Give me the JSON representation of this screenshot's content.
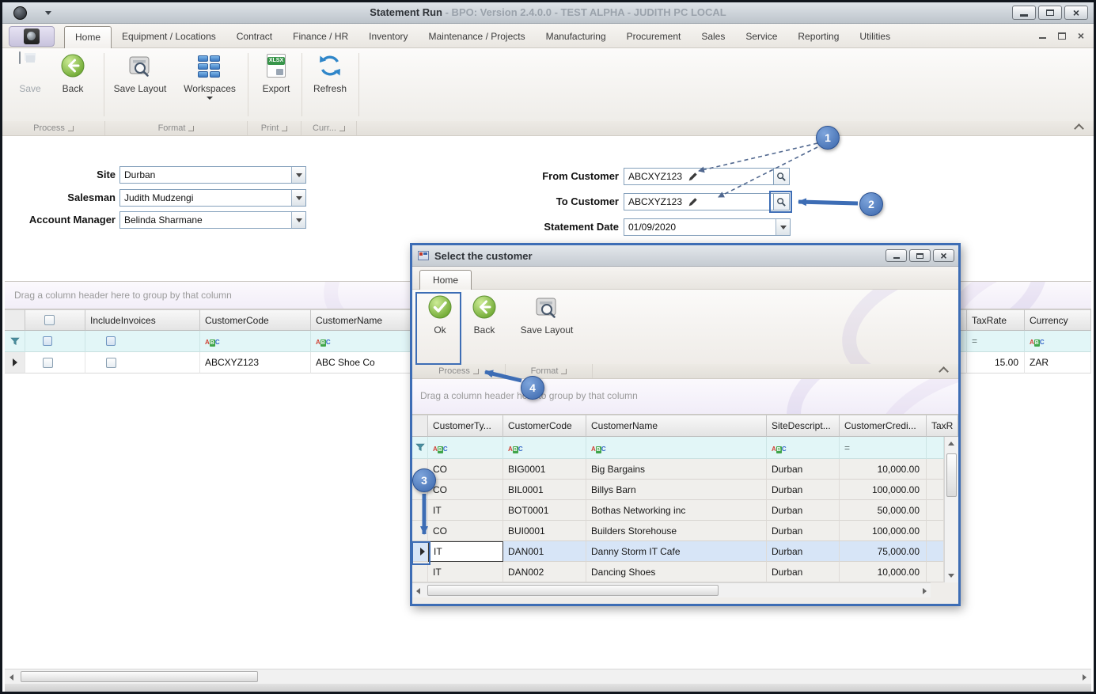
{
  "titlebar": {
    "title": "Statement Run",
    "subtitle": "- BPO: Version 2.4.0.0 - TEST ALPHA - JUDITH PC LOCAL"
  },
  "ribbon": {
    "tabs": [
      {
        "label": "Home"
      },
      {
        "label": "Equipment / Locations"
      },
      {
        "label": "Contract"
      },
      {
        "label": "Finance / HR"
      },
      {
        "label": "Inventory"
      },
      {
        "label": "Maintenance / Projects"
      },
      {
        "label": "Manufacturing"
      },
      {
        "label": "Procurement"
      },
      {
        "label": "Sales"
      },
      {
        "label": "Service"
      },
      {
        "label": "Reporting"
      },
      {
        "label": "Utilities"
      }
    ],
    "buttons": {
      "save": "Save",
      "back": "Back",
      "save_layout": "Save Layout",
      "workspaces": "Workspaces",
      "export": "Export",
      "refresh": "Refresh",
      "export_badge": "XLSX"
    },
    "groups": {
      "process": "Process",
      "format": "Format",
      "print": "Print",
      "curr": "Curr..."
    }
  },
  "form": {
    "site_label": "Site",
    "site_value": "Durban",
    "salesman_label": "Salesman",
    "salesman_value": "Judith Mudzengi",
    "account_manager_label": "Account Manager",
    "account_manager_value": "Belinda Sharmane",
    "from_customer_label": "From Customer",
    "from_customer_value": "ABCXYZ123",
    "to_customer_label": "To Customer",
    "to_customer_value": "ABCXYZ123",
    "statement_date_label": "Statement Date",
    "statement_date_value": "01/09/2020"
  },
  "main_grid": {
    "group_hint": "Drag a column header here to group by that column",
    "columns": {
      "include_invoices": "IncludeInvoices",
      "customer_code": "CustomerCode",
      "customer_name": "CustomerName",
      "tax_rate": "TaxRate",
      "currency": "Currency"
    },
    "filter": {
      "tax_rate_operator": "="
    },
    "row": {
      "customer_code": "ABCXYZ123",
      "customer_name": "ABC Shoe Co",
      "tax_rate": "15.00",
      "currency": "ZAR"
    }
  },
  "dialog": {
    "title": "Select the customer",
    "tab": "Home",
    "buttons": {
      "ok": "Ok",
      "back": "Back",
      "save_layout": "Save Layout"
    },
    "groups": {
      "process": "Process",
      "format": "Format"
    },
    "group_hint": "Drag a column header here to group by that column",
    "columns": {
      "customer_type": "CustomerTy...",
      "customer_code": "CustomerCode",
      "customer_name": "CustomerName",
      "site_description": "SiteDescript...",
      "customer_credit": "CustomerCredi...",
      "tax": "TaxR"
    },
    "filter": {
      "credit_operator": "="
    },
    "rows": [
      {
        "type": "CO",
        "code": "BIG0001",
        "name": "Big Bargains",
        "site": "Durban",
        "credit": "10,000.00"
      },
      {
        "type": "CO",
        "code": "BIL0001",
        "name": "Billys Barn",
        "site": "Durban",
        "credit": "100,000.00"
      },
      {
        "type": "IT",
        "code": "BOT0001",
        "name": "Bothas Networking inc",
        "site": "Durban",
        "credit": "50,000.00"
      },
      {
        "type": "CO",
        "code": "BUI0001",
        "name": "Builders Storehouse",
        "site": "Durban",
        "credit": "100,000.00"
      },
      {
        "type": "IT",
        "code": "DAN001",
        "name": "Danny Storm IT Cafe",
        "site": "Durban",
        "credit": "75,000.00"
      },
      {
        "type": "IT",
        "code": "DAN002",
        "name": "Dancing Shoes",
        "site": "Durban",
        "credit": "10,000.00"
      }
    ]
  },
  "callouts": {
    "one": "1",
    "two": "2",
    "three": "3",
    "four": "4"
  }
}
